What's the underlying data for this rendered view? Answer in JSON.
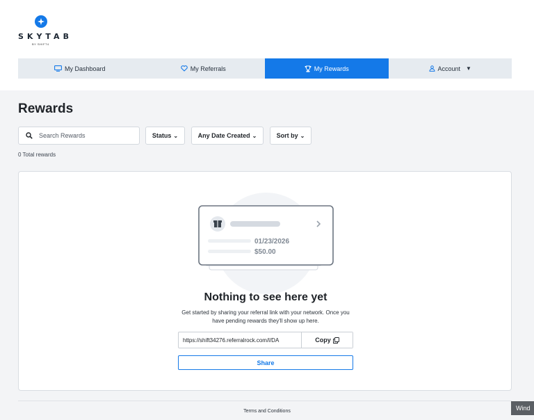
{
  "brand": {
    "name": "SKYTAB",
    "sub": "BY SHIFT4"
  },
  "nav": {
    "dashboard": "My Dashboard",
    "referrals": "My Referrals",
    "rewards": "My Rewards",
    "account": "Account"
  },
  "page": {
    "title": "Rewards"
  },
  "search": {
    "placeholder": "Search Rewards"
  },
  "filters": {
    "status": "Status",
    "date": "Any Date Created",
    "sort": "Sort by"
  },
  "count": "0 Total rewards",
  "illustration": {
    "date": "01/23/2026",
    "amount": "$50.00"
  },
  "empty": {
    "title": "Nothing to see here yet",
    "description": "Get started by sharing your referral link with your network. Once you have pending rewards they'll show up here."
  },
  "referral": {
    "link": "https://shift34276.referralrock.com/l/DA",
    "copy_label": "Copy",
    "share_label": "Share"
  },
  "footer": {
    "terms": "Terms and Conditions"
  },
  "os": {
    "badge": "Wind"
  },
  "colors": {
    "accent": "#1479e8",
    "nav_bg": "#e6ebf0",
    "page_bg": "#f3f4f6"
  }
}
